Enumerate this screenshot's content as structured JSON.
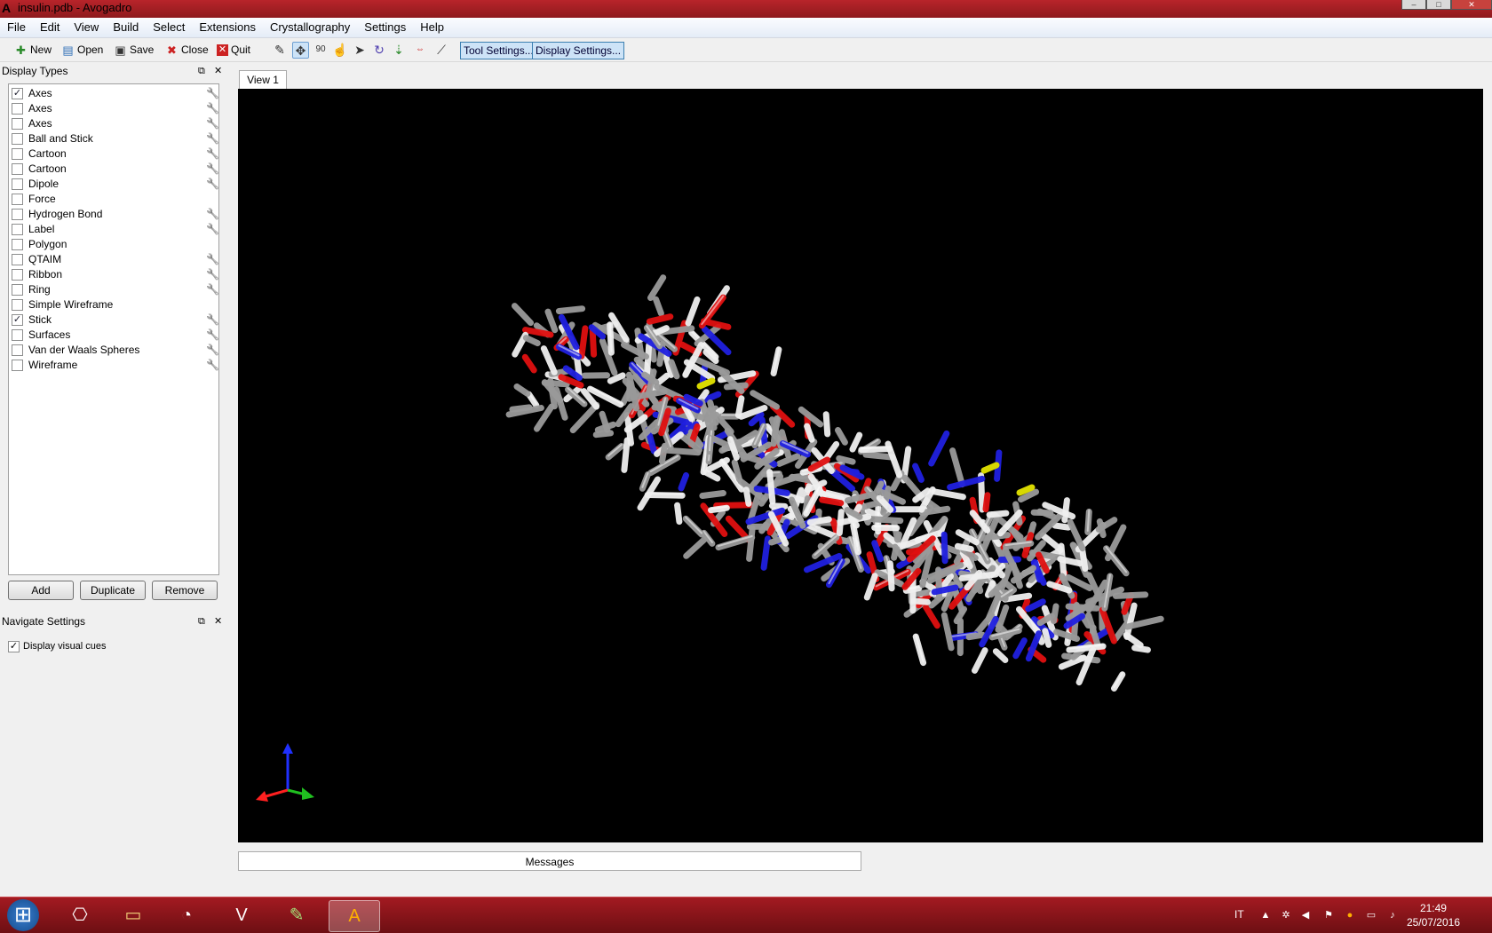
{
  "window": {
    "title": "insulin.pdb - Avogadro"
  },
  "menu": [
    "File",
    "Edit",
    "View",
    "Build",
    "Select",
    "Extensions",
    "Crystallography",
    "Settings",
    "Help"
  ],
  "toolbar": {
    "new_label": "New",
    "open_label": "Open",
    "save_label": "Save",
    "close_label": "Close",
    "quit_label": "Quit",
    "tool_settings": "Tool Settings...",
    "display_settings": "Display Settings..."
  },
  "display_types": {
    "title": "Display Types",
    "items": [
      {
        "label": "Axes",
        "checked": true
      },
      {
        "label": "Axes",
        "checked": false
      },
      {
        "label": "Axes",
        "checked": false
      },
      {
        "label": "Ball and Stick",
        "checked": false
      },
      {
        "label": "Cartoon",
        "checked": false
      },
      {
        "label": "Cartoon",
        "checked": false
      },
      {
        "label": "Dipole",
        "checked": false
      },
      {
        "label": "Force",
        "checked": false
      },
      {
        "label": "Hydrogen Bond",
        "checked": false
      },
      {
        "label": "Label",
        "checked": false
      },
      {
        "label": "Polygon",
        "checked": false
      },
      {
        "label": "QTAIM",
        "checked": false
      },
      {
        "label": "Ribbon",
        "checked": false
      },
      {
        "label": "Ring",
        "checked": false
      },
      {
        "label": "Simple Wireframe",
        "checked": false
      },
      {
        "label": "Stick",
        "checked": true
      },
      {
        "label": "Surfaces",
        "checked": false
      },
      {
        "label": "Van der Waals Spheres",
        "checked": false
      },
      {
        "label": "Wireframe",
        "checked": false
      }
    ],
    "add_label": "Add",
    "duplicate_label": "Duplicate",
    "remove_label": "Remove"
  },
  "navigate_settings": {
    "title": "Navigate Settings",
    "visual_cues_label": "Display visual cues",
    "visual_cues_checked": true
  },
  "view": {
    "tab_label": "View 1",
    "messages_label": "Messages"
  },
  "colors": {
    "carbon": "#9a9a9a",
    "oxygen": "#e01010",
    "nitrogen": "#2020e0",
    "sulfur": "#d8d800",
    "hydrogen": "#f0f0f0"
  },
  "taskbar": {
    "language": "IT",
    "time": "21:49",
    "date": "25/07/2016"
  }
}
